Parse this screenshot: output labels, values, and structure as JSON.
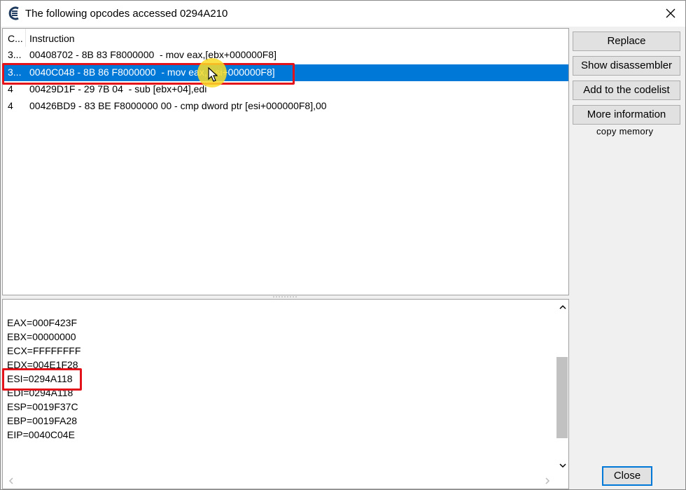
{
  "window": {
    "title": "The following opcodes accessed 0294A210"
  },
  "list": {
    "columns": {
      "count": "C...",
      "instruction": "Instruction"
    },
    "rows": [
      {
        "count": "3...",
        "instruction": "00408702 - 8B 83 F8000000  - mov eax,[ebx+000000F8]"
      },
      {
        "count": "3...",
        "instruction": "0040C048 - 8B 86 F8000000  - mov eax,[esi+000000F8]"
      },
      {
        "count": "4",
        "instruction": "00429D1F - 29 7B 04  - sub [ebx+04],edi"
      },
      {
        "count": "4",
        "instruction": "00426BD9 - 83 BE F8000000 00 - cmp dword ptr [esi+000000F8],00"
      }
    ],
    "selected_row": 1
  },
  "registers": {
    "lines": [
      "EAX=000F423F",
      "EBX=00000000",
      "ECX=FFFFFFFF",
      "EDX=004E1F28",
      "ESI=0294A118",
      "EDI=0294A118",
      "ESP=0019F37C",
      "EBP=0019FA28",
      "EIP=0040C04E"
    ]
  },
  "buttons": {
    "replace": "Replace",
    "show_disassembler": "Show disassembler",
    "add_to_codelist": "Add to the codelist",
    "more_information": "More information",
    "copy_memory": "copy memory",
    "close": "Close"
  },
  "icons": {
    "app": "cheat-engine-icon",
    "close": "close-icon",
    "cursor": "mouse-cursor-icon"
  },
  "colors": {
    "selection": "#0078d7",
    "highlight": "#e3131b",
    "cursor_glow": "#fadc28"
  }
}
